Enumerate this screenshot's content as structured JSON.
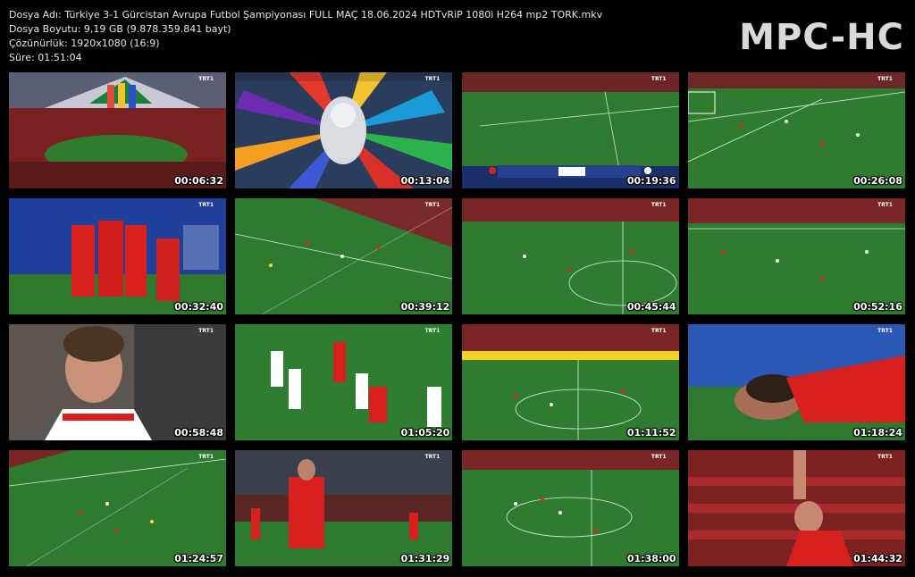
{
  "file_info": {
    "name_line": "Dosya Adı: Türkiye 3-1 Gürcistan Avrupa Futbol Şampiyonası FULL MAÇ 18.06.2024 HDTvRiP 1080i H264 mp2 TORK.mkv",
    "size_line": "Dosya Boyutu: 9,19 GB (9.878.359.841 bayt)",
    "resolution_line": "Çözünürlük: 1920x1080 (16:9)",
    "duration_line": "Süre: 01:51:04"
  },
  "logo": "MPC-HC",
  "channel_tag": "TRT1",
  "thumbnails": [
    {
      "time": "00:06:32"
    },
    {
      "time": "00:13:04"
    },
    {
      "time": "00:19:36"
    },
    {
      "time": "00:26:08"
    },
    {
      "time": "00:32:40"
    },
    {
      "time": "00:39:12"
    },
    {
      "time": "00:45:44"
    },
    {
      "time": "00:52:16"
    },
    {
      "time": "00:58:48"
    },
    {
      "time": "01:05:20"
    },
    {
      "time": "01:11:52"
    },
    {
      "time": "01:18:24"
    },
    {
      "time": "01:24:57"
    },
    {
      "time": "01:31:29"
    },
    {
      "time": "01:38:00"
    },
    {
      "time": "01:44:32"
    }
  ]
}
